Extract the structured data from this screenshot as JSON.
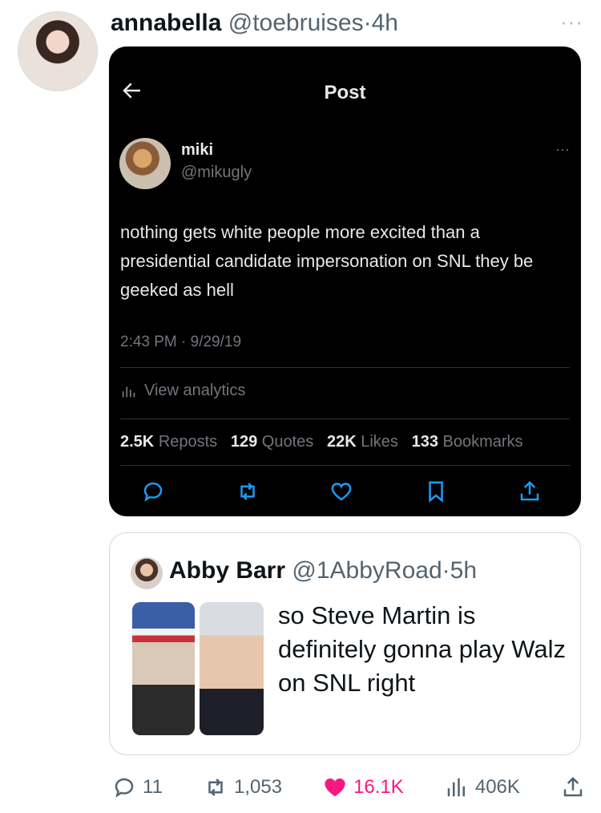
{
  "tweet": {
    "author_name": "annabella",
    "author_handle": "@toebruises",
    "dot": "·",
    "time": "4h",
    "more": "···"
  },
  "embedded_post": {
    "header_title": "Post",
    "author_name": "miki",
    "author_handle": "@mikugly",
    "text": "nothing gets white people more excited than a presidential candidate impersonation on SNL they be geeked as hell",
    "timestamp": "2:43 PM · 9/29/19",
    "analytics_label": "View analytics",
    "stats": {
      "reposts_value": "2.5K",
      "reposts_label": "Reposts",
      "quotes_value": "129",
      "quotes_label": "Quotes",
      "likes_value": "22K",
      "likes_label": "Likes",
      "bookmarks_value": "133",
      "bookmarks_label": "Bookmarks"
    },
    "icons": [
      "reply-icon",
      "retweet-icon",
      "like-icon",
      "bookmark-icon",
      "share-icon"
    ]
  },
  "quoted_tweet": {
    "author_name": "Abby Barr",
    "author_handle": "@1AbbyRoad",
    "dot": "·",
    "time": "5h",
    "text": "so Steve Martin is definitely gonna play Walz on SNL right"
  },
  "engagement": {
    "replies": "11",
    "retweets": "1,053",
    "likes": "16.1K",
    "views": "406K"
  },
  "colors": {
    "like_active": "#f91880",
    "muted": "#536471",
    "dark_card": "#000000"
  }
}
